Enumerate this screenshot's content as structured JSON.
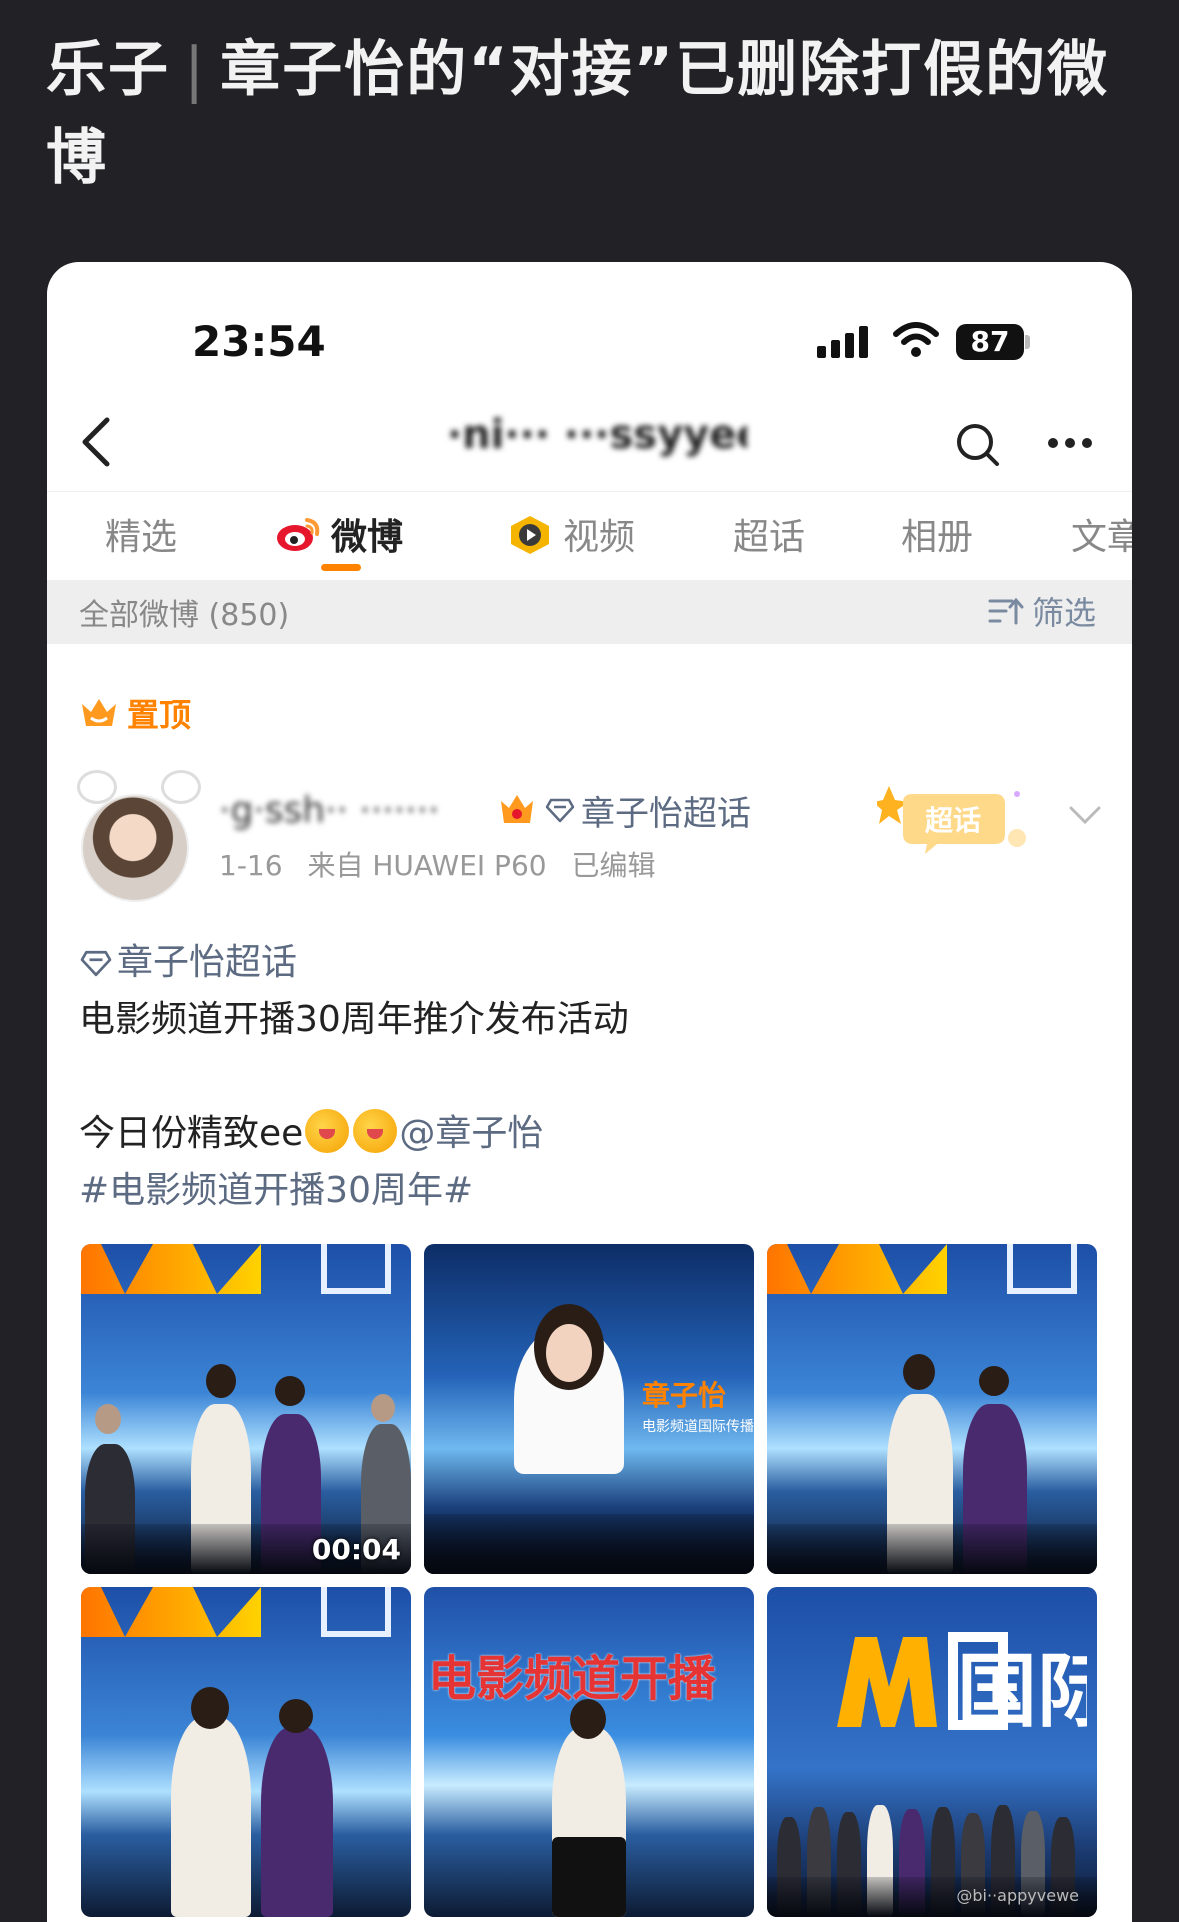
{
  "outer": {
    "title_part1": "乐子",
    "separator": "|",
    "title_part2": "章子怡的“对接”已删除打假的微博"
  },
  "status_bar": {
    "time": "23:54",
    "battery": "87"
  },
  "navbar": {
    "title_blurred": "·ni··· ···ssyyee",
    "back_icon": "chevron-left-icon",
    "search_icon": "search-icon",
    "more_icon": "more-dots-icon"
  },
  "tabs": [
    {
      "label": "精选",
      "active": false
    },
    {
      "label": "微博",
      "active": true,
      "icon": "weibo-logo-icon"
    },
    {
      "label": "视频",
      "active": false,
      "icon": "video-play-icon"
    },
    {
      "label": "超话",
      "active": false
    },
    {
      "label": "相册",
      "active": false
    },
    {
      "label": "文章",
      "active": false
    }
  ],
  "filter_bar": {
    "count_label": "全部微博 (850)",
    "filter_label": "筛选"
  },
  "post": {
    "pinned_label": "置顶",
    "username_blurred": "·g·ssh·· ·······",
    "supertopic_tag": "章子怡超话",
    "meta_date": "1-16",
    "meta_device": "来自 HUAWEI P60",
    "meta_edited": "已编辑",
    "badge_label": "超话",
    "text_tag": "章子怡超话",
    "text_line1": "电影频道开播30周年推介发布活动",
    "text_line2_prefix": "今日份精致ee",
    "text_mention": "@章子怡",
    "text_hashtag": "#电影频道开播30周年#",
    "video_duration": "00:04",
    "screen_name": "章子怡",
    "screen_sub": "电影频道国际传播",
    "screen_banner": "电影频道开播",
    "screen_logo_text": "国际",
    "watermark": "@bi··appyvewe"
  },
  "colors": {
    "accent": "#ff8200",
    "link": "#5c6b82",
    "outer_bg": "#222226"
  }
}
